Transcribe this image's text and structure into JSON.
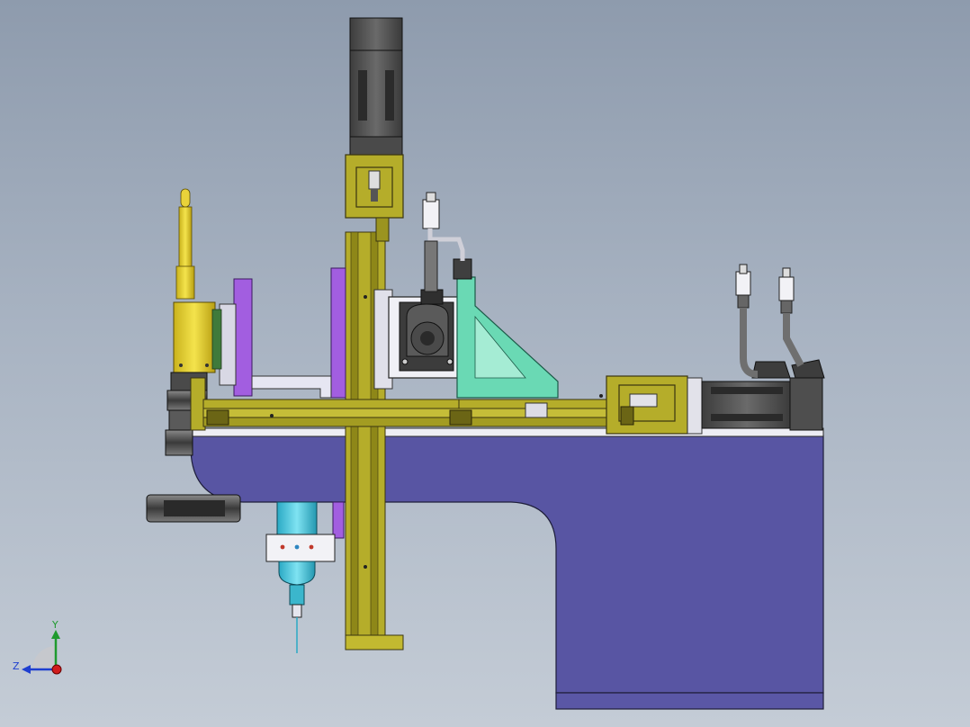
{
  "view": {
    "background_top": "#8e9bad",
    "background_bottom": "#c4ccd6"
  },
  "colors": {
    "base_plate": "#5855a3",
    "rail": "#b5ad2a",
    "rail_dark": "#5a5512",
    "motor": "#555555",
    "motor_dark": "#2f2f2f",
    "purple_plate": "#a25ee0",
    "bracket_teal": "#6ad9b4",
    "camera_yellow": "#e9d23a",
    "nozzle_cyan": "#49c6dc",
    "white_part": "#f2f2f6"
  },
  "triad": {
    "y_label": "Y",
    "z_label": "Z",
    "icons": [
      "arrow-y-icon",
      "arrow-z-icon",
      "origin-x-icon"
    ]
  }
}
